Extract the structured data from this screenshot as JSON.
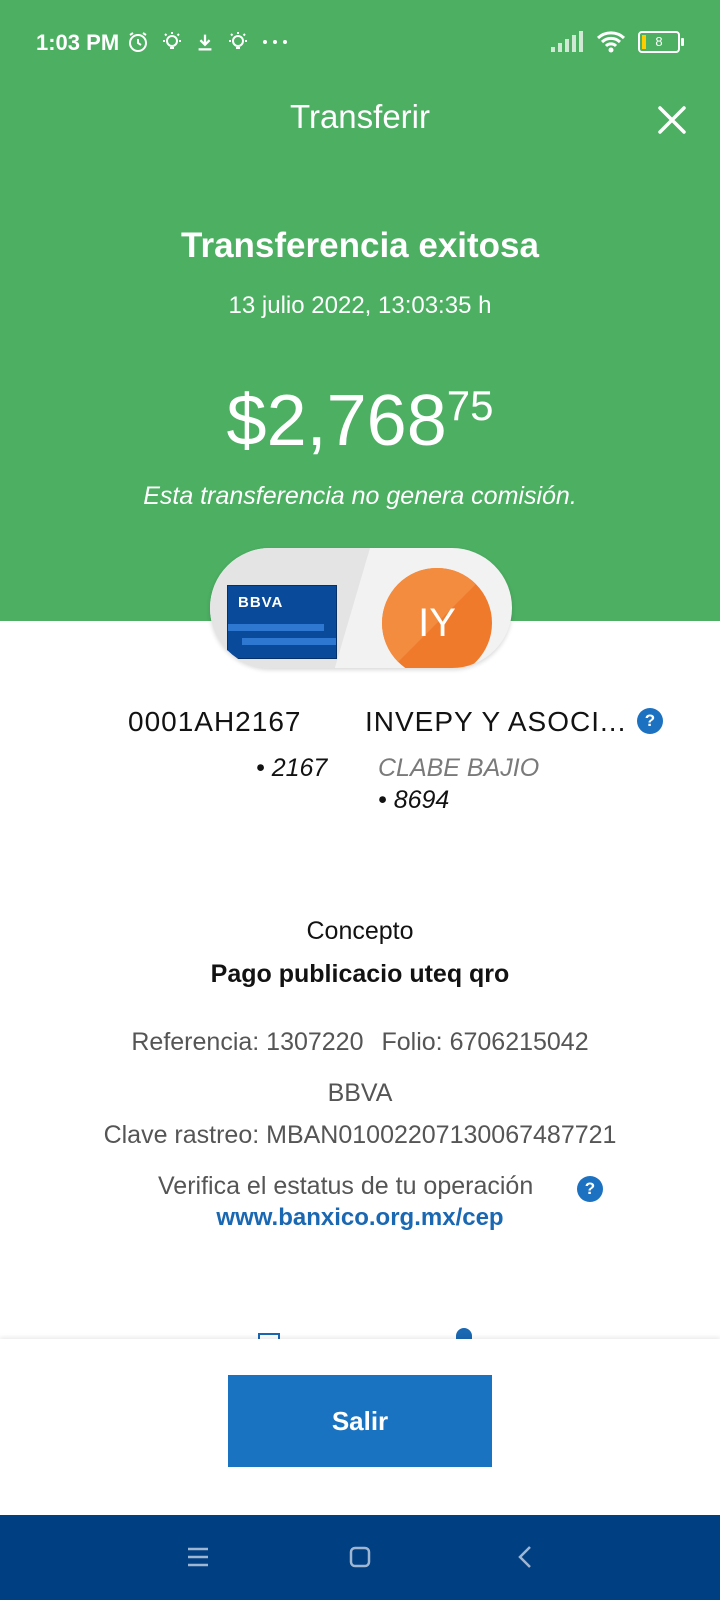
{
  "status_bar": {
    "time": "1:03 PM",
    "battery": "8"
  },
  "header": {
    "title": "Transferir",
    "status": "Transferencia exitosa",
    "datetime": "13 julio 2022, 13:03:35 h",
    "amount_main": "$2,768",
    "amount_cents": "75",
    "commission_note": "Esta transferencia no genera comisión."
  },
  "origin": {
    "card_brand": "BBVA",
    "account_name": "0001AH2167",
    "account_last": "• 2167"
  },
  "destination": {
    "initials": "IY",
    "name": "INVEPY Y ASOCI...",
    "bank": "CLABE BAJIO",
    "account_last": "• 8694"
  },
  "details": {
    "concept_label": "Concepto",
    "concept_value": "Pago publicacio uteq qro",
    "reference": "Referencia: 1307220",
    "folio": "Folio: 6706215042",
    "bank": "BBVA",
    "tracking_key": "Clave rastreo: MBAN01002207130067487721",
    "verify_text": "Verifica el estatus de tu operación",
    "verify_link": "www.banxico.org.mx/cep",
    "help_glyph": "?"
  },
  "footer": {
    "exit_label": "Salir"
  },
  "colors": {
    "header_green": "#4caf62",
    "primary_blue": "#1a73c0",
    "nav_blue": "#003f82",
    "avatar_orange": "#f07a2c"
  }
}
